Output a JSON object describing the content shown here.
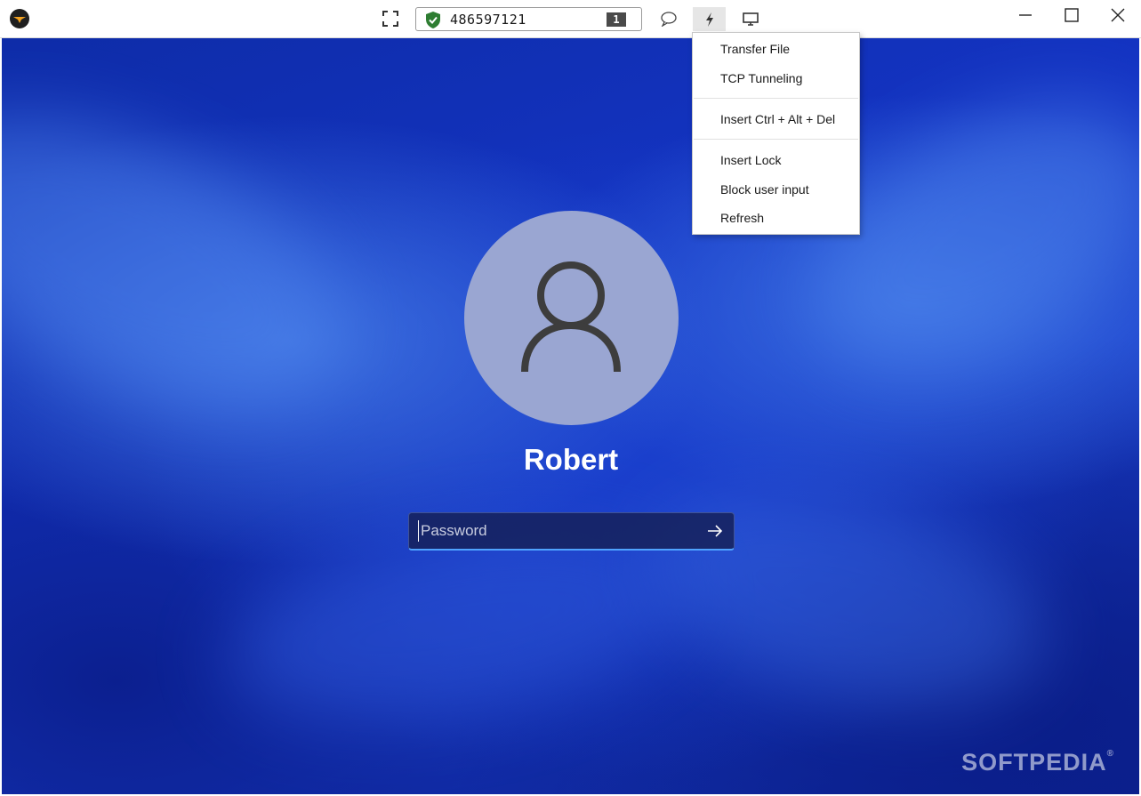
{
  "toolbar": {
    "connection_id": "486597121",
    "session_count": "1",
    "accent_color": "#2e7d32"
  },
  "menu": {
    "items": [
      {
        "label": "Transfer File"
      },
      {
        "label": "TCP Tunneling"
      },
      {
        "label": "Insert Ctrl + Alt + Del"
      },
      {
        "label": "Insert Lock"
      },
      {
        "label": "Block user input"
      },
      {
        "label": "Refresh"
      }
    ]
  },
  "login": {
    "username": "Robert",
    "password_placeholder": "Password"
  },
  "watermark": {
    "text": "SOFTPEDIA",
    "mark": "®"
  }
}
